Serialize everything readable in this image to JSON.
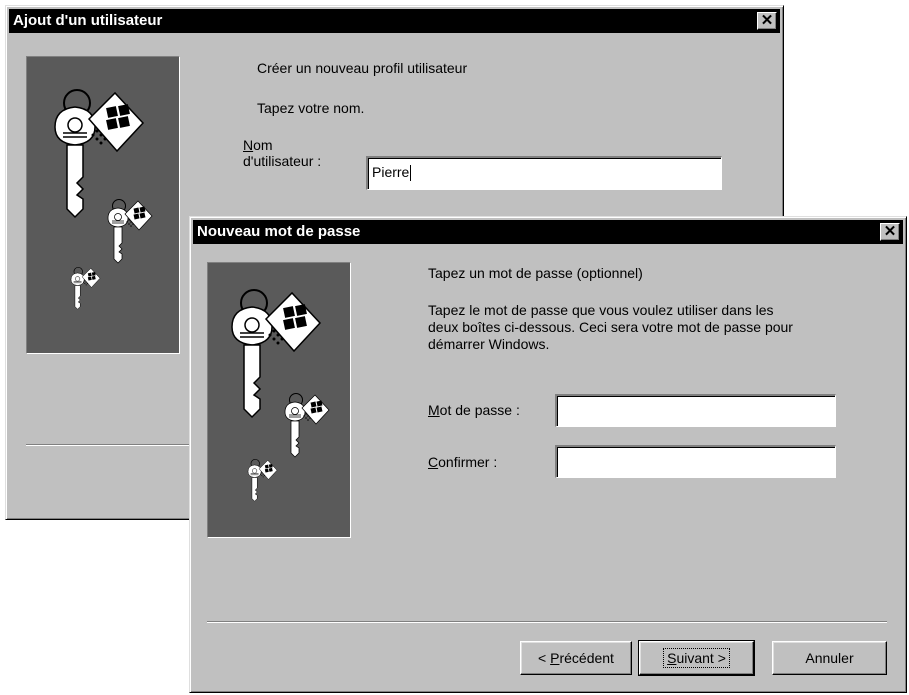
{
  "back_dialog": {
    "title": "Ajout d'un utilisateur",
    "close_label": "✕",
    "heading": "Créer un nouveau profil utilisateur",
    "instruction": "Tapez votre nom.",
    "username_label_line1_accel": "N",
    "username_label_line1_rest": "om",
    "username_label_line2": "d'utilisateur :",
    "username_value": "Pierre"
  },
  "front_dialog": {
    "title": "Nouveau mot de passe",
    "close_label": "✕",
    "heading": "Tapez un mot de passe (optionnel)",
    "description_line1": "Tapez le mot de passe que vous voulez utiliser dans les",
    "description_line2": "deux boîtes ci-dessous. Ceci sera votre mot de passe pour",
    "description_line3": "démarrer Windows.",
    "password_label_accel": "M",
    "password_label_rest": "ot de passe :",
    "password_value": "",
    "confirm_label_accel": "C",
    "confirm_label_rest": "onfirmer :",
    "confirm_value": "",
    "buttons": {
      "back_prefix": "< ",
      "back_accel": "P",
      "back_rest": "récédent",
      "next_accel": "S",
      "next_rest": "uivant >",
      "cancel": "Annuler"
    }
  },
  "icons": {
    "close": "close-icon",
    "keys_art": "keys-icon"
  }
}
